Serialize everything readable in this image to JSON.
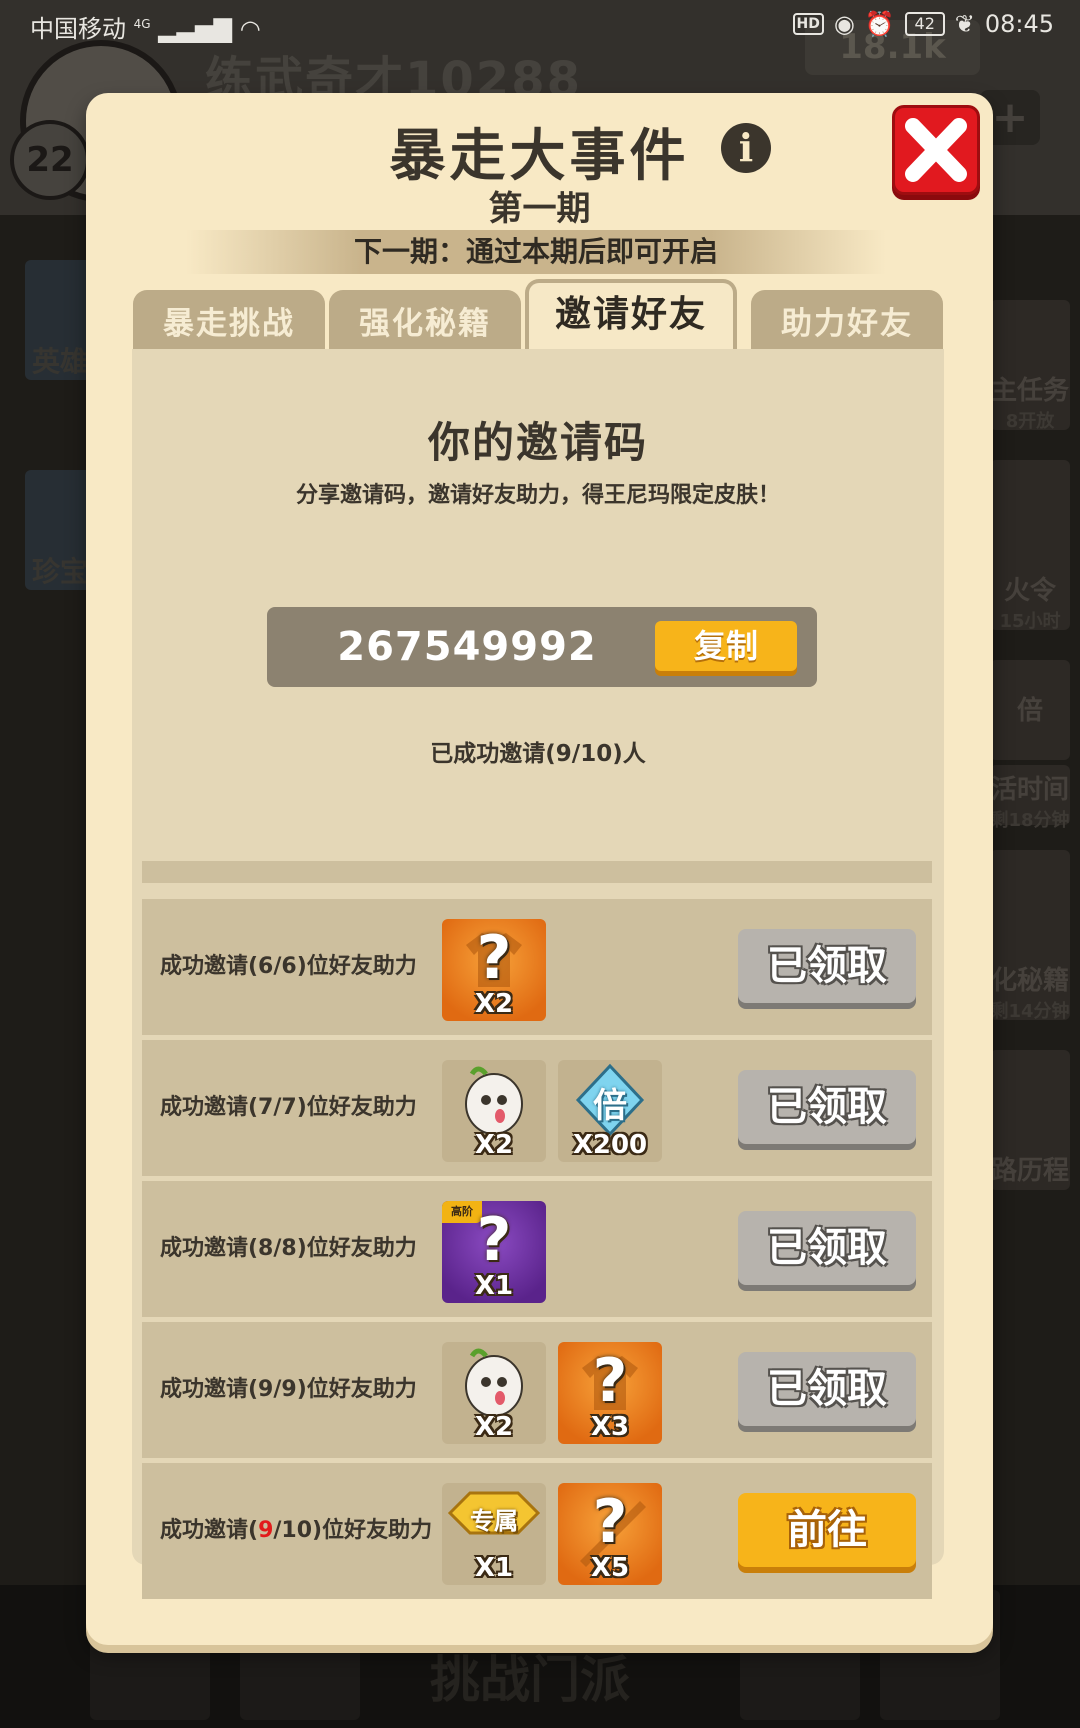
{
  "status_bar": {
    "carrier": "中国移动",
    "network": "4G",
    "hd_badge": "HD",
    "battery": "42",
    "time": "08:45"
  },
  "background": {
    "level": "22",
    "username": "练武奇才10288",
    "currency": "18.1k",
    "left_side": [
      "英雄",
      "珍宝"
    ],
    "right_side": [
      {
        "title": "主任务",
        "sub": "8开放"
      },
      {
        "title": "火令",
        "sub": "15小时"
      },
      {
        "title": "倍",
        "sub": ""
      },
      {
        "title": "活时间",
        "sub": "剩18分钟"
      },
      {
        "title": "化秘籍",
        "sub": "剩14分钟"
      },
      {
        "title": "路历程",
        "sub": ""
      }
    ],
    "dock_label": "挑战门派"
  },
  "modal": {
    "title": "暴走大事件",
    "subtitle": "第一期",
    "next_period": "下一期：通过本期后即可开启",
    "tabs": [
      {
        "label": "暴走挑战",
        "active": false
      },
      {
        "label": "强化秘籍",
        "active": false
      },
      {
        "label": "邀请好友",
        "active": true
      },
      {
        "label": "助力好友",
        "active": false
      }
    ],
    "invite": {
      "title": "你的邀请码",
      "description": "分享邀请码，邀请好友助力，得王尼玛限定皮肤！",
      "code": "267549992",
      "copy_label": "复制",
      "invited_count": "已成功邀请(9/10)人"
    },
    "rows": [
      {
        "label": "成功邀请(6/6)位好友助力",
        "rewards": [
          {
            "icon": "mystery-shirt-icon",
            "qty": "X2",
            "style": "orange"
          }
        ],
        "button": "已领取",
        "status": "claimed"
      },
      {
        "label": "成功邀请(7/7)位好友助力",
        "rewards": [
          {
            "icon": "wangnima-avatar-icon",
            "qty": "X2",
            "style": "tan"
          },
          {
            "icon": "double-diamond-icon",
            "glyph": "倍",
            "qty": "X200",
            "style": "tan"
          }
        ],
        "button": "已领取",
        "status": "claimed"
      },
      {
        "label": "成功邀请(8/8)位好友助力",
        "rewards": [
          {
            "icon": "advanced-mystery-icon",
            "tag": "高阶",
            "qty": "X1",
            "style": "purple"
          }
        ],
        "button": "已领取",
        "status": "claimed"
      },
      {
        "label": "成功邀请(9/9)位好友助力",
        "rewards": [
          {
            "icon": "wangnima-avatar-icon",
            "qty": "X2",
            "style": "tan"
          },
          {
            "icon": "mystery-shirt-icon",
            "qty": "X3",
            "style": "orange"
          }
        ],
        "button": "已领取",
        "status": "claimed"
      },
      {
        "label_prefix": "成功邀请(",
        "label_highlight": "9",
        "label_suffix": "/10)位好友助力",
        "rewards": [
          {
            "icon": "exclusive-badge-icon",
            "glyph": "专属",
            "qty": "X1",
            "style": "tan"
          },
          {
            "icon": "mystery-sword-icon",
            "qty": "X5",
            "style": "orange"
          }
        ],
        "button": "前往",
        "status": "go"
      }
    ]
  },
  "colors": {
    "modal_bg": "#f8e9c5",
    "panel_bg": "#e4d7b7",
    "row_bg": "#cdbf9e",
    "accent_orange": "#f7b41a",
    "close_red": "#e1191f",
    "claimed_gray": "#b7b3ad",
    "highlight_red": "#e21b1b"
  }
}
